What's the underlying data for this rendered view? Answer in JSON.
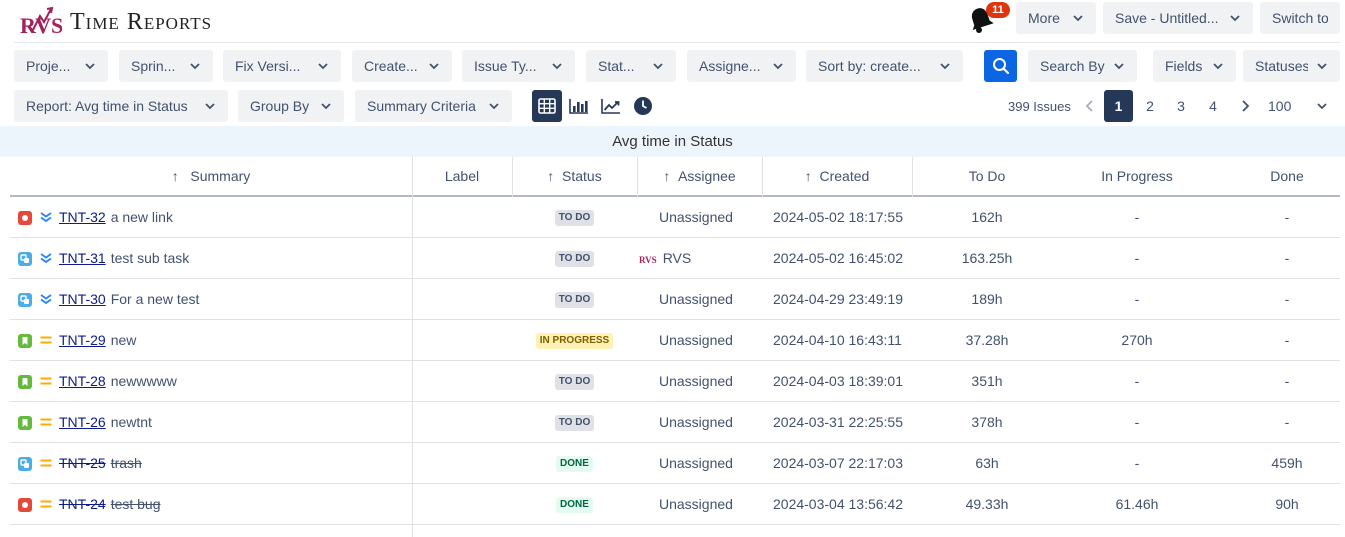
{
  "header": {
    "title": "Time Reports",
    "logo_text": "RVS",
    "notifications_count": "11",
    "more_label": "More",
    "save_label": "Save - Untitled...",
    "switch_label": "Switch to"
  },
  "filters": [
    {
      "id": "project",
      "label": "Proje..."
    },
    {
      "id": "sprint",
      "label": "Sprin..."
    },
    {
      "id": "fix-version",
      "label": "Fix Versi..."
    },
    {
      "id": "created",
      "label": "Create..."
    },
    {
      "id": "issue-type",
      "label": "Issue Ty..."
    },
    {
      "id": "status",
      "label": "Stat..."
    },
    {
      "id": "assignee",
      "label": "Assigne..."
    },
    {
      "id": "sort-by",
      "label": "Sort by: create..."
    }
  ],
  "search_by_label": "Search By",
  "fields_label": "Fields",
  "statuses_label": "Statuses",
  "report_selector_label": "Report: Avg time in Status",
  "group_by_label": "Group By",
  "summary_criteria_label": "Summary Criteria",
  "views": [
    "grid-icon",
    "bar-chart-icon",
    "line-chart-icon",
    "clock-icon"
  ],
  "pagination": {
    "issues_count": "399 Issues",
    "pages": [
      "1",
      "2",
      "3",
      "4"
    ],
    "current": "1",
    "page_size": "100"
  },
  "report_title": "Avg time in Status",
  "columns": {
    "summary": "Summary",
    "label": "Label",
    "status": "Status",
    "assignee": "Assignee",
    "created": "Created",
    "todo": "To Do",
    "in_progress": "In Progress",
    "done": "Done"
  },
  "rows": [
    {
      "key": "TNT-32",
      "summary": "a new link",
      "type": "bug",
      "priority": "lowest",
      "status": "TO DO",
      "status_kind": "todo",
      "assignee": "Unassigned",
      "assignee_avatar": "",
      "created": "2024-05-02 18:17:55",
      "todo": "162h",
      "in_progress": "-",
      "done": "-",
      "resolved": false
    },
    {
      "key": "TNT-31",
      "summary": "test sub task",
      "type": "subtask",
      "priority": "lowest",
      "status": "TO DO",
      "status_kind": "todo",
      "assignee": "RVS",
      "assignee_avatar": "RVS",
      "created": "2024-05-02 16:45:02",
      "todo": "163.25h",
      "in_progress": "-",
      "done": "-",
      "resolved": false
    },
    {
      "key": "TNT-30",
      "summary": "For a new test",
      "type": "subtask",
      "priority": "lowest",
      "status": "TO DO",
      "status_kind": "todo",
      "assignee": "Unassigned",
      "assignee_avatar": "",
      "created": "2024-04-29 23:49:19",
      "todo": "189h",
      "in_progress": "-",
      "done": "-",
      "resolved": false
    },
    {
      "key": "TNT-29",
      "summary": "new",
      "type": "story",
      "priority": "medium",
      "status": "IN PROGRESS",
      "status_kind": "prog",
      "assignee": "Unassigned",
      "assignee_avatar": "",
      "created": "2024-04-10 16:43:11",
      "todo": "37.28h",
      "in_progress": "270h",
      "done": "-",
      "resolved": false
    },
    {
      "key": "TNT-28",
      "summary": "newwwww",
      "type": "story",
      "priority": "medium",
      "status": "TO DO",
      "status_kind": "todo",
      "assignee": "Unassigned",
      "assignee_avatar": "",
      "created": "2024-04-03 18:39:01",
      "todo": "351h",
      "in_progress": "-",
      "done": "-",
      "resolved": false
    },
    {
      "key": "TNT-26",
      "summary": "newtnt",
      "type": "story",
      "priority": "medium",
      "status": "TO DO",
      "status_kind": "todo",
      "assignee": "Unassigned",
      "assignee_avatar": "",
      "created": "2024-03-31 22:25:55",
      "todo": "378h",
      "in_progress": "-",
      "done": "-",
      "resolved": false
    },
    {
      "key": "TNT-25",
      "summary": "trash",
      "type": "subtask",
      "priority": "medium",
      "status": "DONE",
      "status_kind": "done",
      "assignee": "Unassigned",
      "assignee_avatar": "",
      "created": "2024-03-07 22:17:03",
      "todo": "63h",
      "in_progress": "-",
      "done": "459h",
      "resolved": true
    },
    {
      "key": "TNT-24",
      "summary": "test bug",
      "type": "bug",
      "priority": "medium",
      "status": "DONE",
      "status_kind": "done",
      "assignee": "Unassigned",
      "assignee_avatar": "",
      "created": "2024-03-04 13:56:42",
      "todo": "49.33h",
      "in_progress": "61.46h",
      "done": "90h",
      "resolved": true
    }
  ],
  "colors": {
    "bug": "#e5493a",
    "subtask": "#4bade8",
    "story": "#63ba3c",
    "priority_lowest": "#2684ff",
    "priority_medium": "#ffab00",
    "accent": "#0c66e4"
  }
}
